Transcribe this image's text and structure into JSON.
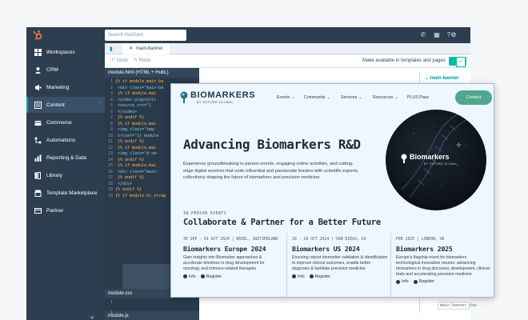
{
  "topbar": {
    "search_placeholder": "Search HubSpot"
  },
  "sidebar": {
    "items": [
      {
        "label": "Workspaces"
      },
      {
        "label": "CRM"
      },
      {
        "label": "Marketing"
      },
      {
        "label": "Content"
      },
      {
        "label": "Commerce"
      },
      {
        "label": "Automations"
      },
      {
        "label": "Reporting & Data"
      },
      {
        "label": "Library"
      },
      {
        "label": "Template Marketplace"
      },
      {
        "label": "Partner"
      }
    ],
    "active": "Content"
  },
  "editor": {
    "file_tab": "main-banner",
    "undo_label": "↶ Undo",
    "redo_label": "↷ Redo",
    "available_label": "Make available in templates and pages",
    "available_enabled": true,
    "html_pane_title": "module.html (HTML + HubL)",
    "css_pane_title": "module.css",
    "js_pane_title": "module.js",
    "code_lines": [
      {
        "n": "1",
        "text": "{% if module.main_ba"
      },
      {
        "n": "2",
        "text": "  <div class=\"main-ba"
      },
      {
        "n": "3",
        "text": "    {% if module.mai"
      },
      {
        "n": "4",
        "text": "    <video playsinli"
      },
      {
        "n": "5",
        "text": "      <source src=\"{"
      },
      {
        "n": "6",
        "text": "    </video>"
      },
      {
        "n": "7",
        "text": "    {% endif %}"
      },
      {
        "n": "8",
        "text": "    {% if module.mai"
      },
      {
        "n": "9",
        "text": "    <img class=\"img-"
      },
      {
        "n": "10",
        "text": "    srcset=\"{{ module"
      },
      {
        "n": "11",
        "text": "    {% endif %}"
      },
      {
        "n": "12",
        "text": "    {% if module.mai"
      },
      {
        "n": "13",
        "text": "    <img class=\"d-sm-"
      },
      {
        "n": "14",
        "text": "    {% endif %}"
      },
      {
        "n": "15",
        "text": "    {% if module.mai"
      },
      {
        "n": "16",
        "text": "    <div class=\"main-"
      },
      {
        "n": "17",
        "text": "    {% endif %}"
      },
      {
        "n": "18",
        "text": "  </div>"
      },
      {
        "n": "19",
        "text": "{% endif %}"
      },
      {
        "n": "20",
        "text": "{% if module.hi_strap"
      }
    ],
    "css_line": "1",
    "js_line": "1",
    "right_tab": "main-banner",
    "right_field": "main_banner_cha"
  },
  "site": {
    "brand_name": "BIOMARKERS",
    "brand_sub": "BY OXFORD GLOBAL",
    "nav": [
      {
        "label": "Events"
      },
      {
        "label": "Community"
      },
      {
        "label": "Services"
      },
      {
        "label": "Resources"
      }
    ],
    "plus_pass": "PLUS Pass",
    "contact": "Contact",
    "hero_title": "Advancing Biomarkers R&D",
    "hero_text": "Experience groundbreaking in-person events, engaging online activities, and cutting-edge digital services that unite influential and passionate leaders with scientific experts, collectively shaping the future of biomarkers and precision medicine.",
    "circle_title": "Biomarkers",
    "circle_sub": "BY OXFORD GLOBAL",
    "events_eyebrow": "IN-PERSON EVENTS",
    "events_title": "Collaborate & Partner for a Better Future",
    "events": [
      {
        "date": "30 SEP - 01 OCT 2024 | BASEL, SWITZERLAND",
        "title": "Biomarkers Europe 2024",
        "desc": "Gain insights into Biomarker approaches & accelerate timelines in drug development for oncology and immuno-related therapies",
        "info": "Info",
        "register": "Register"
      },
      {
        "date": "29 - 29 OCT 2024 | SAN DIEGO, CA",
        "title": "Biomarkers US 2024",
        "desc": "Ensuring robust biomarker validation & identification to improve clinical outcomes, enable better diagnosis & facilitate precision medicine",
        "info": "Info",
        "register": "Register"
      },
      {
        "date": "FEB 2025 | LONDON, UK",
        "title": "Biomarkers 2025",
        "desc": "Europe's flagship event for biomarkers technological innovation returns: advancing biomarkers in drug discovery, development, clinical trials and accelerating precision medicine",
        "info": "Info",
        "register": "Register"
      }
    ]
  },
  "colors": {
    "sidebar": "#2d3e50",
    "accent": "#00a4bd",
    "toggle": "#00bda5",
    "contact": "#4fa78d"
  }
}
